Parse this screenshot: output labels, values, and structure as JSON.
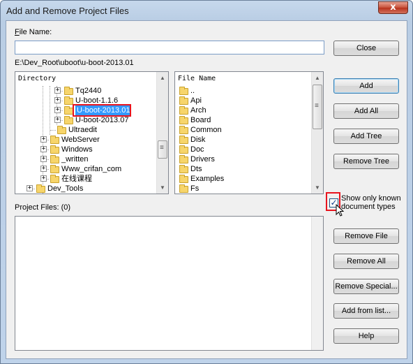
{
  "window": {
    "title": "Add and Remove Project Files",
    "close_glyph": "x"
  },
  "file_name": {
    "label_prefix": "F",
    "label_rest": "ile Name:",
    "value": ""
  },
  "current_path": "E:\\Dev_Root\\uboot\\u-boot-2013.01",
  "directory_pane": {
    "header": "Directory",
    "items": [
      {
        "label": "Tq2440",
        "expander": "+",
        "selected": false
      },
      {
        "label": "U-boot-1.1.6",
        "expander": "+",
        "selected": false
      },
      {
        "label": "U-boot-2013.01",
        "expander": "+",
        "selected": true
      },
      {
        "label": "U-boot-2013.07",
        "expander": "+",
        "selected": false
      },
      {
        "label": "Ultraedit",
        "expander": "",
        "selected": false
      },
      {
        "label": "WebServer",
        "expander": "+",
        "selected": false
      },
      {
        "label": "Windows",
        "expander": "+",
        "selected": false
      },
      {
        "label": "_written",
        "expander": "+",
        "selected": false
      },
      {
        "label": "Www_crifan_com",
        "expander": "+",
        "selected": false
      },
      {
        "label": "在线课程",
        "expander": "+",
        "selected": false
      },
      {
        "label": "Dev_Tools",
        "expander": "+",
        "selected": false
      }
    ]
  },
  "file_pane": {
    "header": "File Name",
    "items": [
      "..",
      "Api",
      "Arch",
      "Board",
      "Common",
      "Disk",
      "Doc",
      "Drivers",
      "Dts",
      "Examples",
      "Fs"
    ]
  },
  "project_files": {
    "label": "Project Files: (0)"
  },
  "checkbox": {
    "label_line1": "Show only known",
    "label_line2": "document types",
    "checked": true,
    "check_glyph": "✓"
  },
  "buttons": {
    "close": "Close",
    "add": "Add",
    "add_all": "Add All",
    "add_tree": "Add Tree",
    "remove_tree": "Remove Tree",
    "remove_file": "Remove File",
    "remove_all": "Remove All",
    "remove_special": "Remove Special...",
    "add_from_list": "Add from list...",
    "help": "Help"
  },
  "scroll_glyphs": {
    "up": "▲",
    "down": "▼",
    "grip": "≡"
  },
  "colors": {
    "selection": "#3399ff",
    "highlight_box": "#e8141e",
    "folder": "#f7d56b"
  }
}
